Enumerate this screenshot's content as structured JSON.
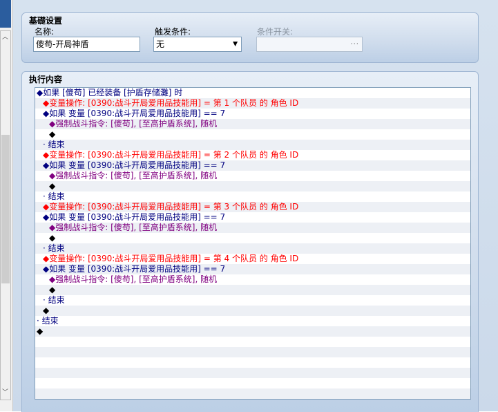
{
  "basic_settings": {
    "title": "基礎设置",
    "name_label": "名称:",
    "name_value": "傻苟-开局神盾",
    "trigger_label": "触发条件:",
    "trigger_value": "无",
    "switch_label": "条件开关:",
    "switch_button": "..."
  },
  "execution": {
    "title": "执行内容",
    "rows": [
      {
        "indent": 0,
        "color": "blue",
        "text": "◆如果 [傻苟] 已经装备 [护盾存储灘] 时"
      },
      {
        "indent": 1,
        "color": "red",
        "text": "◆变量操作: [0390:战斗开局爱用品技能用] = 第 1 个队员 的 角色 ID"
      },
      {
        "indent": 1,
        "color": "blue",
        "text": "◆如果 变量 [0390:战斗开局爱用品技能用] == 7"
      },
      {
        "indent": 2,
        "color": "purple",
        "text": "◆强制战斗指令: [傻苟], [至高护盾系统], 随机"
      },
      {
        "indent": 2,
        "color": "black",
        "text": "◆"
      },
      {
        "indent": 1,
        "color": "blue",
        "text": "· 结束"
      },
      {
        "indent": 1,
        "color": "red",
        "text": "◆变量操作: [0390:战斗开局爱用品技能用] = 第 2 个队员 的 角色 ID"
      },
      {
        "indent": 1,
        "color": "blue",
        "text": "◆如果 变量 [0390:战斗开局爱用品技能用] == 7"
      },
      {
        "indent": 2,
        "color": "purple",
        "text": "◆强制战斗指令: [傻苟], [至高护盾系统], 随机"
      },
      {
        "indent": 2,
        "color": "black",
        "text": "◆"
      },
      {
        "indent": 1,
        "color": "blue",
        "text": "· 结束"
      },
      {
        "indent": 1,
        "color": "red",
        "text": "◆变量操作: [0390:战斗开局爱用品技能用] = 第 3 个队员 的 角色 ID"
      },
      {
        "indent": 1,
        "color": "blue",
        "text": "◆如果 变量 [0390:战斗开局爱用品技能用] == 7"
      },
      {
        "indent": 2,
        "color": "purple",
        "text": "◆强制战斗指令: [傻苟], [至高护盾系统], 随机"
      },
      {
        "indent": 2,
        "color": "black",
        "text": "◆"
      },
      {
        "indent": 1,
        "color": "blue",
        "text": "· 结束"
      },
      {
        "indent": 1,
        "color": "red",
        "text": "◆变量操作: [0390:战斗开局爱用品技能用] = 第 4 个队员 的 角色 ID"
      },
      {
        "indent": 1,
        "color": "blue",
        "text": "◆如果 变量 [0390:战斗开局爱用品技能用] == 7"
      },
      {
        "indent": 2,
        "color": "purple",
        "text": "◆强制战斗指令: [傻苟], [至高护盾系统], 随机"
      },
      {
        "indent": 2,
        "color": "black",
        "text": "◆"
      },
      {
        "indent": 1,
        "color": "blue",
        "text": "· 结束"
      },
      {
        "indent": 1,
        "color": "black",
        "text": "◆"
      },
      {
        "indent": 0,
        "color": "blue",
        "text": "· 结束"
      },
      {
        "indent": 0,
        "color": "black",
        "text": "◆"
      },
      {
        "indent": 0,
        "color": "black",
        "text": ""
      },
      {
        "indent": 0,
        "color": "black",
        "text": ""
      },
      {
        "indent": 0,
        "color": "black",
        "text": ""
      },
      {
        "indent": 0,
        "color": "black",
        "text": ""
      },
      {
        "indent": 0,
        "color": "black",
        "text": ""
      },
      {
        "indent": 0,
        "color": "black",
        "text": ""
      }
    ]
  }
}
